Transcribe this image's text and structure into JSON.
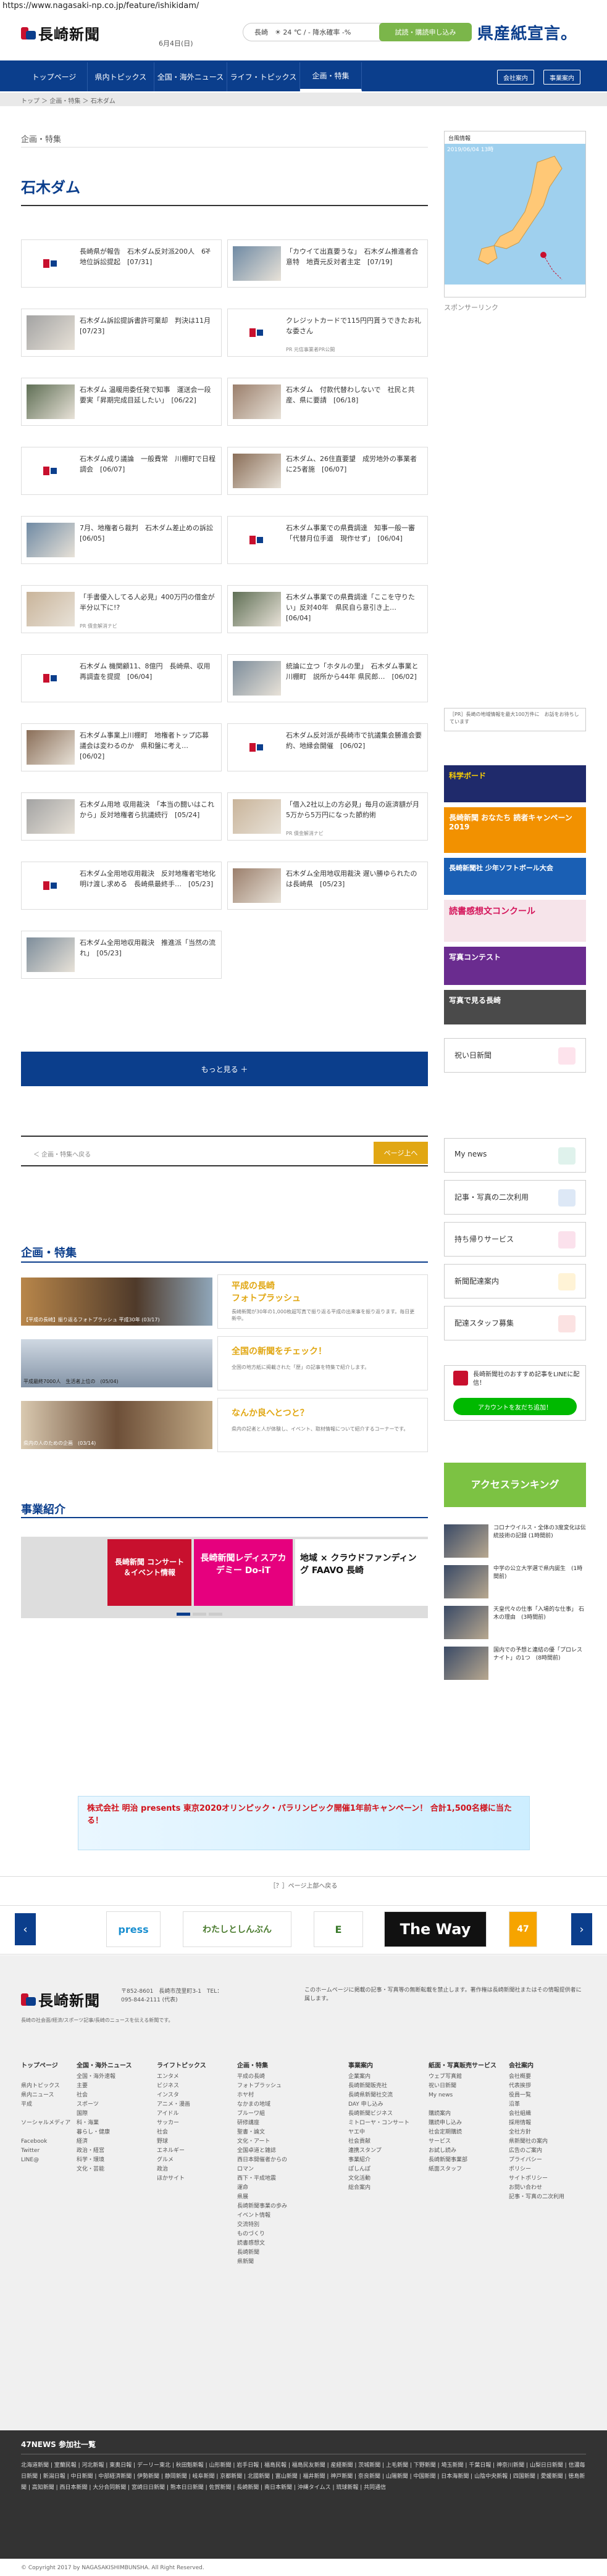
{
  "url": "https://www.nagasaki-np.co.jp/feature/ishikidam/",
  "header": {
    "logo_text": "長崎新聞",
    "date": "6月4日(日)",
    "weather": "長崎　☀ 24 ℃ / - 降水確率 -%",
    "weather_button": "試読・購読申し込み",
    "banner": "県産紙宣言。"
  },
  "nav": {
    "items": [
      "トップページ",
      "県内トピックス",
      "全国・海外ニュース",
      "ライフ・トピックス",
      "企画・特集"
    ],
    "sub": [
      "会社案内",
      "事業案内"
    ]
  },
  "breadcrumb": "トップ ＞ 企画・特集 ＞ 石木ダム",
  "section_label": "企画・特集",
  "page_title": "石木ダム",
  "articles": [
    {
      "text": "長崎県が報告　石木ダム反対派200人　6ች地位訴訟提起　[07/31]",
      "sub": ""
    },
    {
      "text": "「カウイて出直要うな」　石木ダム推進者合意特　地責元反対者主定　[07/19]",
      "sub": ""
    },
    {
      "text": "石木ダム訴訟提訴書許可棄却　判決は11月　[07/23]",
      "sub": ""
    },
    {
      "text": "クレジットカードで115円円貰うできたお礼な委さん",
      "sub": "PR 元信事業者PR公開"
    },
    {
      "text": "石木ダム 温暖用委任発で知事　運送会一段要実「昇期完成目延したい」　[06/22]",
      "sub": ""
    },
    {
      "text": "石木ダム　付款代替わしないで　社民と共産、県に要請　[06/18]",
      "sub": ""
    },
    {
      "text": "石木ダム成り議論　一般費常　川棚町で日程調会　[06/07]",
      "sub": ""
    },
    {
      "text": "石木ダム、26住直要望　成労地外の事業者に25者施　[06/07]",
      "sub": ""
    },
    {
      "text": "7月、地権者ら裁判　石木ダム差止めの訴訟　[06/05]",
      "sub": ""
    },
    {
      "text": "石木ダム事業での県費調達　知事一般一審「代替月位手道　現作せず」　[06/04]",
      "sub": ""
    },
    {
      "text": "「手書優入してる人必見」400万円の借金が半分以下に!?",
      "sub": "PR 債金解消ナビ"
    },
    {
      "text": "石木ダム事業での県費調達「ここを守りたい」反対40年　県民自ら意引き上…　[06/04]",
      "sub": ""
    },
    {
      "text": "石木ダム 機関顧11、8億円　長崎県、収用再調査を提提　[06/04]",
      "sub": ""
    },
    {
      "text": "統論に立つ「ホタルの里」　石木ダム事業と川棚町　説所から44年 県民郎…　[06/02]",
      "sub": ""
    },
    {
      "text": "石木ダム事業上川棚町　地権者トップ応募　議会は変わるのか　県和盤に考え…　[06/02]",
      "sub": ""
    },
    {
      "text": "石木ダム反対派が長崎市で抗議集会勝進会要約、地縁会開催　[06/02]",
      "sub": ""
    },
    {
      "text": "石木ダム用地 収用裁決　「本当の闘いはこれから」反対地権者ら抗議続行　[05/24]",
      "sub": ""
    },
    {
      "text": "「借入2社以上の方必見」毎月の返済額が月5万から5万円になった節約術",
      "sub": "PR 債金解消ナビ"
    },
    {
      "text": "石木ダム全用地収用裁決　反対地権者宅地化 明け渡し求める　長崎県最終手…　[05/23]",
      "sub": ""
    },
    {
      "text": "石木ダム全用地収用裁決 遅い勝ゆられたのは長崎県　[05/23]",
      "sub": ""
    },
    {
      "text": "石木ダム全用地収用裁決　推進派「当然の流れ」　[05/23]",
      "sub": ""
    }
  ],
  "more_label": "もっと見る ＋",
  "pager": {
    "left": "＜ 企画・特集へ戻る",
    "right": "ページ上へ"
  },
  "features_title": "企画・特集",
  "features": [
    {
      "title": "平成の長崎\nフォトプラッシュ",
      "desc": "長崎新聞が30年の1,000枚超写真で振り返る平成の出来事を振り返ります。毎日更新中。",
      "caption": "【平成の長崎】振り返るフォトプラッシュ 平成30年 (03/17)"
    },
    {
      "title": "全国の新聞をチェック！",
      "desc": "全国の地方紙に掲載された「歴」の記事を特集で紹介します。",
      "caption": "平成最終7000人　生活者上位の　(05/04)"
    },
    {
      "title": "なんか良へとつと？",
      "desc": "県内の記者と人が体験し、イベント、取材情報について紹介するコーナーです。",
      "caption": "県内の人のための企画　(03/14)"
    }
  ],
  "business_title": "事業紹介",
  "business_banners": [
    "長崎新聞 コンサート＆イベント情報",
    "長崎新聞レディスアカデミー Do-iT",
    "地域 × クラウドファンディング FAAVO 長崎"
  ],
  "sidebar": {
    "map_label": "台風情報",
    "map_date": "2019/06/04 13時",
    "sponsor": "スポンサーリンク",
    "pr_text": "［PR］長崎の地域情報を最大100万件に　お話をお待ちしています",
    "ads": [
      "科学ボード",
      "長崎新聞 おなたち 読者キャンペーン2019",
      "長崎新聞社 少年ソフトボール大会",
      "読書感想文コンクール",
      "写真コンテスト",
      "写真で見る長崎"
    ],
    "buttons": [
      "祝い日新聞",
      "My news",
      "記事・写真の二次利用",
      "持ち帰りサービス",
      "新聞配達案内",
      "配達スタッフ募集"
    ],
    "line_text": "長崎新聞社のおすすめ記事をLINEに配信！",
    "line_button": "アカウントを友だち追加！",
    "ranking_title": "アクセスランキング",
    "side_news": [
      "コロナウイルス・全体の3度変化は伝統技術の記録 (1時間前)",
      "中学の公立大学選で県内誕生　(1時間前)",
      "天皇代々の仕事「入場的な仕事」 石木の理由　(3時間前)",
      "国内での予想と連結の優「プロレスナイト」の1つ　(8時間前)"
    ]
  },
  "footer_ad": "株式会社 明治 presents 東京2020オリンピック・パラリンピック開催1年前キャンペーン！ 合計1,500名様に当たる！",
  "footer_note": "［？］ページ上部へ戻る",
  "partners": [
    "press",
    "わたしとしんぶん",
    "E",
    "The Way",
    "47"
  ],
  "footer": {
    "address": "〒852-8601　長崎市茂里町3-1　TEL：095-844-2111 (代表)",
    "desc": "長崎の社会面/経済/スポーツ記事/長崎のニュースを伝える新聞です。",
    "notice": "このホームページに掲載の記事・写真等の無断転載を禁止します。著作権は長崎新聞社またはその情報提供者に属します。",
    "cols": [
      {
        "head": "トップページ",
        "items": [
          "",
          "県内トピックス",
          "県内ニュース",
          "平成",
          "",
          "ソーシャルメディア",
          "",
          "Facebook",
          "Twitter",
          "LINE@"
        ]
      },
      {
        "head": "全国・海外ニュース",
        "items": [
          "全国・海外速報",
          "主要",
          "社会",
          "スポーツ",
          "国際",
          "科・海業",
          "暮らし・健康",
          "経済",
          "政治・経営",
          "科学・環境",
          "文化・芸能"
        ]
      },
      {
        "head": "ライフトピックス",
        "items": [
          "エンタメ",
          "ビジネス",
          "インスタ",
          "アニメ・漫画",
          "アイドル",
          "サッカー",
          "社会",
          "野球",
          "エネルギー",
          "グルメ",
          "政治",
          "ほかサイト"
        ]
      },
      {
        "head": "企画・特集",
        "items": [
          "平成の長崎",
          "フォトプラッシュ",
          "ホヤ村",
          "なかまの地域",
          "ブルーワ組",
          "研修講座",
          "聖書・論文",
          "文化・アート",
          "全国卓道と雑誌",
          "西日本開催者からの",
          "ロマン",
          "西下・平成地震",
          "運命",
          "県展",
          "長崎新聞事業の歩み",
          "イベント情報",
          "交流特別",
          "ものづくり",
          "読書感想文",
          "長崎新聞",
          "県新聞"
        ]
      },
      {
        "head": "事業案内",
        "items": [
          "企業案内",
          "長崎新聞販売社",
          "長崎県新聞社交流",
          "DAY 申し込み",
          "長崎新聞ビジネス",
          "ミトローヤ・コンサート",
          "ヤエ中",
          "社会貢献",
          "連携スタンプ",
          "事業紹介",
          "ぽしんぽ",
          "文化活動",
          "総合案内"
        ]
      },
      {
        "head": "紙面・写真販売サービス",
        "items": [
          "ウェブ写真館",
          "祝い日新聞",
          "My news",
          "",
          "購読案内",
          "購読申し込み",
          "社会定期購読",
          "サービス",
          "お試し読み",
          "長崎新聞事業部",
          "紙面スタッフ"
        ]
      },
      {
        "head": "会社案内",
        "items": [
          "会社概要",
          "代表挨拶",
          "役員一覧",
          "沿革",
          "会社組織",
          "採用情報",
          "全社方針",
          "県新聞社の案内",
          "広告のご案内",
          "プライバシー",
          "ポリシー",
          "サイトポリシー",
          "お問い合わせ",
          "記事・写真の二次利用"
        ]
      }
    ]
  },
  "news47": {
    "title": "47NEWS 参加社一覧",
    "text": "北海道新聞 | 室蘭民報 | 河北新報 | 東奥日報 | デーリー東北 | 秋田魁新報 | 山形新聞 | 岩手日報 | 福島民報 | 福島民友新聞 | 産経新聞 | 茨城新聞 | 上毛新聞 | 下野新聞 | 埼玉新聞 | 千葉日報 | 神奈川新聞 | 山梨日日新聞 | 信濃毎日新聞 | 新潟日報 | 中日新聞 | 中部経済新聞 | 伊勢新聞 | 静岡新聞 | 岐阜新聞 | 京都新聞 | 北國新聞 | 富山新聞 | 福井新聞 | 神戸新聞 | 奈良新聞 | 山陽新聞 | 中国新聞 | 日本海新聞 | 山陰中央新報 | 四国新聞 | 愛媛新聞 | 徳島新聞 | 高知新聞 | 西日本新聞 | 大分合同新聞 | 宮崎日日新聞 | 熊本日日新聞 | 佐賀新聞 | 長崎新聞 | 南日本新聞 | 沖縄タイムス | 琉球新報 | 共同通信"
  },
  "copyright": "© Copyright 2017 by NAGASAKISHIMBUNSHA. All Right Reserved.",
  "colors": {
    "brand": "#0b3e8c",
    "accent": "#e1a713",
    "green": "#7bb64a"
  }
}
